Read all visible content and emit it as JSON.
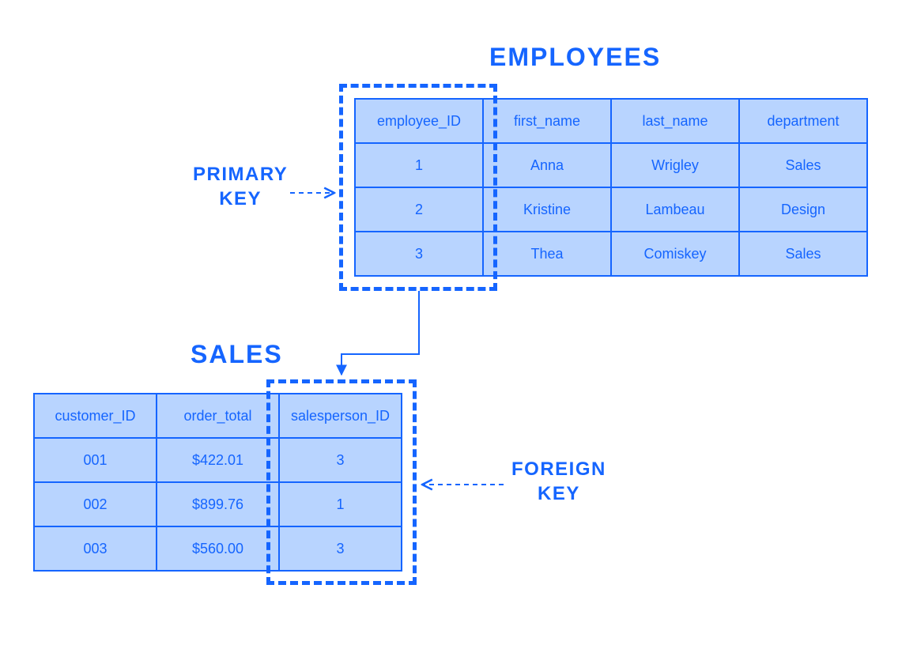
{
  "titles": {
    "employees": "EMPLOYEES",
    "sales": "SALES"
  },
  "labels": {
    "primary_key_line1": "PRIMARY",
    "primary_key_line2": "KEY",
    "foreign_key_line1": "FOREIGN",
    "foreign_key_line2": "KEY"
  },
  "employees_table": {
    "headers": [
      "employee_ID",
      "first_name",
      "last_name",
      "department"
    ],
    "rows": [
      [
        "1",
        "Anna",
        "Wrigley",
        "Sales"
      ],
      [
        "2",
        "Kristine",
        "Lambeau",
        "Design"
      ],
      [
        "3",
        "Thea",
        "Comiskey",
        "Sales"
      ]
    ]
  },
  "sales_table": {
    "headers": [
      "customer_ID",
      "order_total",
      "salesperson_ID"
    ],
    "rows": [
      [
        "001",
        "$422.01",
        "3"
      ],
      [
        "002",
        "$899.76",
        "1"
      ],
      [
        "003",
        "$560.00",
        "3"
      ]
    ]
  },
  "colors": {
    "primary": "#1565ff",
    "cell_bg": "#b8d4ff"
  }
}
